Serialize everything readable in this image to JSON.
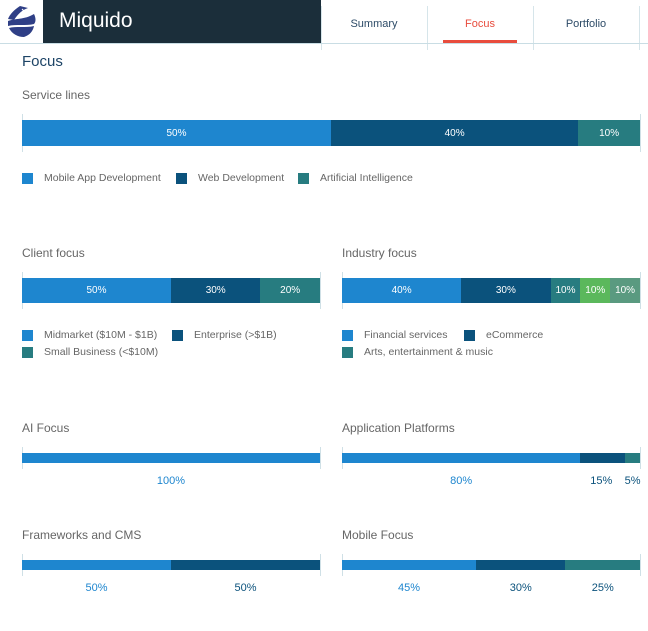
{
  "header": {
    "brand": "Miquido",
    "logo_icon": "miquido-logo-icon",
    "tabs": [
      {
        "label": "Summary",
        "active": false
      },
      {
        "label": "Focus",
        "active": true
      },
      {
        "label": "Portfolio",
        "active": false
      }
    ]
  },
  "page_title": "Focus",
  "colors": {
    "c1": "#1e86cf",
    "c2": "#0b527c",
    "c3": "#277c80",
    "c4": "#5bb85c",
    "c5": "#5a9a80",
    "accent": "#e84c3d"
  },
  "chart_data": [
    {
      "type": "bar",
      "title": "Service lines",
      "orientation": "stacked-horizontal",
      "categories": [
        "Mobile App Development",
        "Web Development",
        "Artificial Intelligence"
      ],
      "values": [
        50,
        40,
        10
      ],
      "labels": [
        "50%",
        "40%",
        "10%"
      ],
      "legend": "bottom"
    },
    {
      "type": "bar",
      "title": "Client focus",
      "orientation": "stacked-horizontal",
      "categories": [
        "Midmarket ($10M - $1B)",
        "Enterprise (>$1B)",
        "Small Business (<$10M)"
      ],
      "values": [
        50,
        30,
        20
      ],
      "labels": [
        "50%",
        "30%",
        "20%"
      ],
      "legend": "bottom"
    },
    {
      "type": "bar",
      "title": "Industry focus",
      "orientation": "stacked-horizontal",
      "categories": [
        "Financial services",
        "eCommerce",
        "Arts, entertainment & music",
        "",
        ""
      ],
      "legend_entries": [
        "Financial services",
        "eCommerce",
        "Arts, entertainment & music"
      ],
      "values": [
        40,
        30,
        10,
        10,
        10
      ],
      "labels": [
        "40%",
        "30%",
        "10%",
        "10%",
        "10%"
      ],
      "legend": "bottom"
    },
    {
      "type": "bar",
      "title": "AI Focus",
      "orientation": "stacked-horizontal",
      "values": [
        100
      ],
      "labels": [
        "100%"
      ]
    },
    {
      "type": "bar",
      "title": "Application Platforms",
      "orientation": "stacked-horizontal",
      "values": [
        80,
        15,
        5
      ],
      "labels": [
        "80%",
        "15%",
        "5%"
      ]
    },
    {
      "type": "bar",
      "title": "Frameworks and CMS",
      "orientation": "stacked-horizontal",
      "values": [
        50,
        50
      ],
      "labels": [
        "50%",
        "50%"
      ]
    },
    {
      "type": "bar",
      "title": "Mobile Focus",
      "orientation": "stacked-horizontal",
      "values": [
        45,
        30,
        25
      ],
      "labels": [
        "45%",
        "30%",
        "25%"
      ]
    }
  ]
}
